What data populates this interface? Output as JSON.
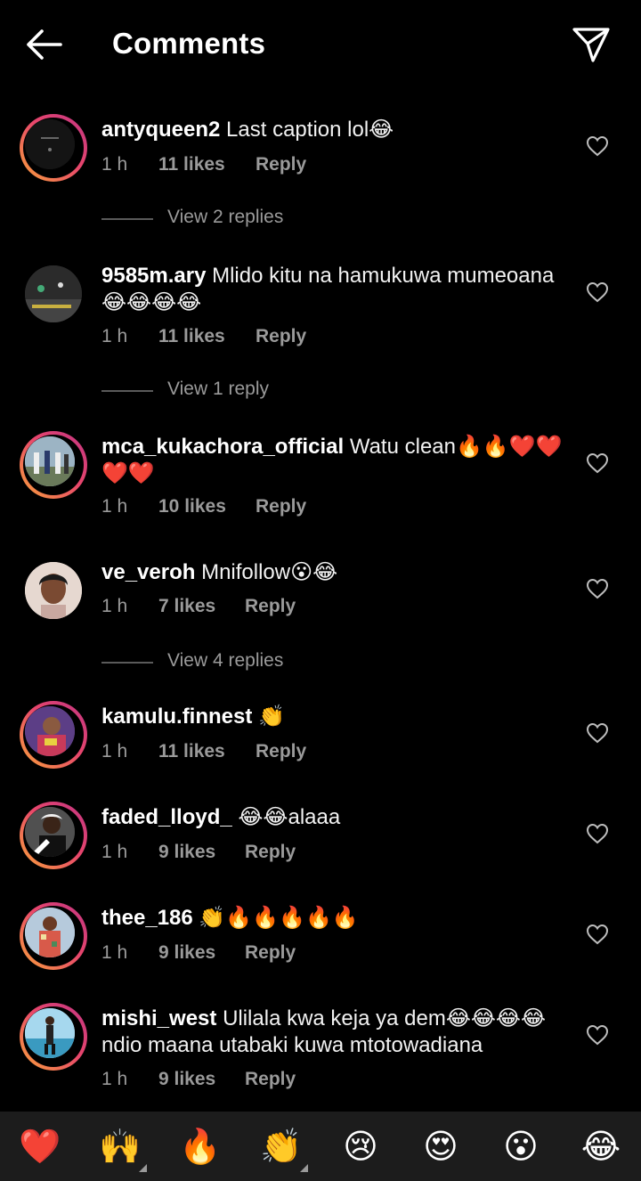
{
  "header": {
    "title": "Comments",
    "back_icon": "arrow-left-icon",
    "send_icon": "paper-plane-icon"
  },
  "labels": {
    "reply": "Reply"
  },
  "comments": [
    {
      "user": "antyqueen2",
      "text": "Last caption lol😂",
      "time": "1 h",
      "likes": "11 likes",
      "replies_label": "View 2 replies",
      "story_ring": true
    },
    {
      "user": "9585m.ary",
      "text": "Mlido kitu na hamukuwa mumeoana😂😂😂😂",
      "time": "1 h",
      "likes": "11 likes",
      "replies_label": "View 1 reply",
      "story_ring": false
    },
    {
      "user": "mca_kukachora_official",
      "text": "Watu clean🔥🔥❤️❤️❤️❤️",
      "time": "1 h",
      "likes": "10 likes",
      "story_ring": true
    },
    {
      "user": "ve_veroh",
      "text": "Mnifollow😮😂",
      "time": "1 h",
      "likes": "7 likes",
      "replies_label": "View 4 replies",
      "story_ring": false
    },
    {
      "user": "kamulu.finnest",
      "text": "👏",
      "time": "1 h",
      "likes": "11 likes",
      "story_ring": true
    },
    {
      "user": "faded_lloyd_",
      "text": "😂😂alaaa",
      "time": "1 h",
      "likes": "9 likes",
      "story_ring": true
    },
    {
      "user": "thee_186",
      "text": "👏🔥🔥🔥🔥🔥",
      "time": "1 h",
      "likes": "9 likes",
      "story_ring": true
    },
    {
      "user": "mishi_west",
      "text": "Ulilala kwa keja ya dem😂😂😂😂 ndio maana utabaki kuwa mtotowadiana",
      "time": "1 h",
      "likes": "9 likes",
      "story_ring": true
    }
  ],
  "emoji_bar": [
    "❤️",
    "🙌",
    "🔥",
    "👏",
    "😢",
    "😍",
    "😮",
    "😂"
  ],
  "colors": {
    "background": "#000000",
    "secondary_text": "#9a9a9a",
    "ring_start": "#f9a33a",
    "ring_end": "#c13584",
    "emoji_bar_bg": "#1c1c1c"
  }
}
